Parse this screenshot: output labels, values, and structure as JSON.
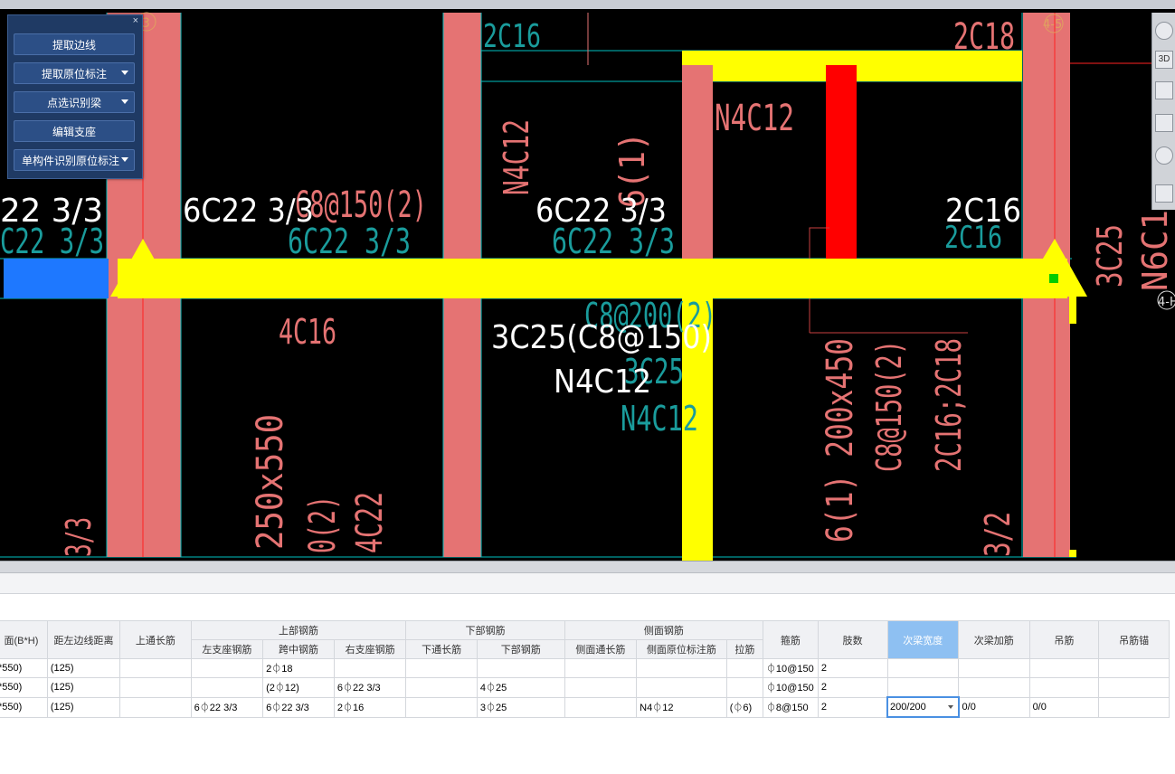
{
  "floating_panel": {
    "close": "×",
    "buttons": [
      {
        "label": "提取边线",
        "dropdown": false
      },
      {
        "label": "提取原位标注",
        "dropdown": true
      },
      {
        "label": "点选识别梁",
        "dropdown": true
      },
      {
        "label": "编辑支座",
        "dropdown": false
      },
      {
        "label": "单构件识别原位标注",
        "dropdown": true
      }
    ]
  },
  "view_tools": {
    "items": [
      "3D",
      "",
      "",
      "",
      ""
    ]
  },
  "cad_labels": {
    "white_1": "22 3/3",
    "white_2": "6C22 3/3",
    "white_3": "6C22 3/3",
    "white_4": "2C16",
    "white_5": "3C25(C8@150)",
    "white_6": "N4C12",
    "teal_1": "C22 3/3",
    "teal_2": "6C22 3/3",
    "teal_3": "6C22 3/3",
    "teal_4": "2C16",
    "teal_5": "2C16",
    "teal_6": "C8@200(2)",
    "teal_7": "3C25",
    "teal_8": "N4C12",
    "red_1": "C8@150(2)",
    "red_2": "N4C12",
    "red_3": "2C18",
    "red_4": "6(1)",
    "red_5": "4C16",
    "red_6": "250x550",
    "red_7": "0(2)",
    "red_8": "4C22",
    "red_9": "6(1) 200x450",
    "red_10": "C8@150(2)",
    "red_11": "2C16;2C18",
    "red_12": "3C25",
    "red_13": "N6C1",
    "red_14": "3/3",
    "red_15": "3/2",
    "axis_1": "3",
    "axis_2": "4-5",
    "axis_3": "4-H"
  },
  "grid": {
    "group_headers": {
      "top": "上部钢筋",
      "bottom": "下部钢筋",
      "side": "侧面钢筋"
    },
    "headers": {
      "section": "面(B*H)",
      "offset": "距左边线距离",
      "top_through": "上通长筋",
      "left_support": "左支座钢筋",
      "mid_span": "跨中钢筋",
      "right_support": "右支座钢筋",
      "bottom_through": "下通长筋",
      "bottom_bar": "下部钢筋",
      "side_through": "侧面通长筋",
      "side_mark": "侧面原位标注筋",
      "tie": "拉筋",
      "stirrup": "箍筋",
      "legs": "肢数",
      "sec_width": "次梁宽度",
      "sec_add": "次梁加筋",
      "hanger": "吊筋",
      "hanger_anchor": "吊筋锚"
    },
    "rows": [
      {
        "section": "*550)",
        "offset": "(125)",
        "top_through": "",
        "left_support": "",
        "mid_span": "2⏀18",
        "right_support": "",
        "bottom_through": "",
        "bottom_bar": "",
        "side_through": "",
        "side_mark": "",
        "tie": "",
        "stirrup": "⏀10@150",
        "legs": "2",
        "sec_width": "",
        "sec_add": "",
        "hanger": "",
        "hanger_anchor": ""
      },
      {
        "section": "*550)",
        "offset": "(125)",
        "top_through": "",
        "left_support": "",
        "mid_span": "(2⏀12)",
        "right_support": "6⏀22 3/3",
        "bottom_through": "",
        "bottom_bar": "4⏀25",
        "side_through": "",
        "side_mark": "",
        "tie": "",
        "stirrup": "⏀10@150",
        "legs": "2",
        "sec_width": "",
        "sec_add": "",
        "hanger": "",
        "hanger_anchor": ""
      },
      {
        "section": "*550)",
        "offset": "(125)",
        "top_through": "",
        "left_support": "6⏀22 3/3",
        "mid_span": "6⏀22 3/3",
        "right_support": "2⏀16",
        "bottom_through": "",
        "bottom_bar": "3⏀25",
        "side_through": "",
        "side_mark": "N4⏀12",
        "tie": "(⏀6)",
        "stirrup": "⏀8@150",
        "legs": "2",
        "sec_width": "200/200",
        "sec_add": "0/0",
        "hanger": "0/0",
        "hanger_anchor": ""
      }
    ]
  }
}
